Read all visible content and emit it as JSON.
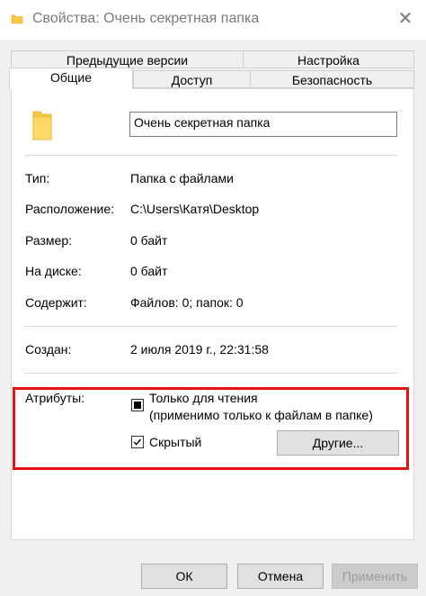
{
  "window": {
    "title": "Свойства: Очень секретная папка",
    "close_glyph": "✕"
  },
  "tabs": {
    "row_back": [
      "Предыдущие версии",
      "Настройка"
    ],
    "row_front": [
      "Общие",
      "Доступ",
      "Безопасность"
    ],
    "active": "Общие"
  },
  "general": {
    "folder_name": "Очень секретная папка",
    "fields": [
      {
        "label": "Тип:",
        "value": "Папка с файлами"
      },
      {
        "label": "Расположение:",
        "value": "C:\\Users\\Катя\\Desktop"
      },
      {
        "label": "Размер:",
        "value": "0 байт"
      },
      {
        "label": "На диске:",
        "value": "0 байт"
      },
      {
        "label": "Содержит:",
        "value": "Файлов: 0; папок: 0"
      }
    ],
    "created": {
      "label": "Создан:",
      "value": "2 июля 2019 г., 22:31:58"
    }
  },
  "attributes": {
    "label": "Атрибуты:",
    "readonly_line1": "Только для чтения",
    "readonly_line2": "(применимо только к файлам в папке)",
    "hidden_label": "Скрытый",
    "other_button": "Другие..."
  },
  "footer": {
    "ok": "ОК",
    "cancel": "Отмена",
    "apply": "Применить"
  },
  "colors": {
    "folder": "#f5c842",
    "highlight": "#e01212"
  },
  "icons": [
    "folder-icon",
    "close-icon",
    "checkmark-icon"
  ]
}
